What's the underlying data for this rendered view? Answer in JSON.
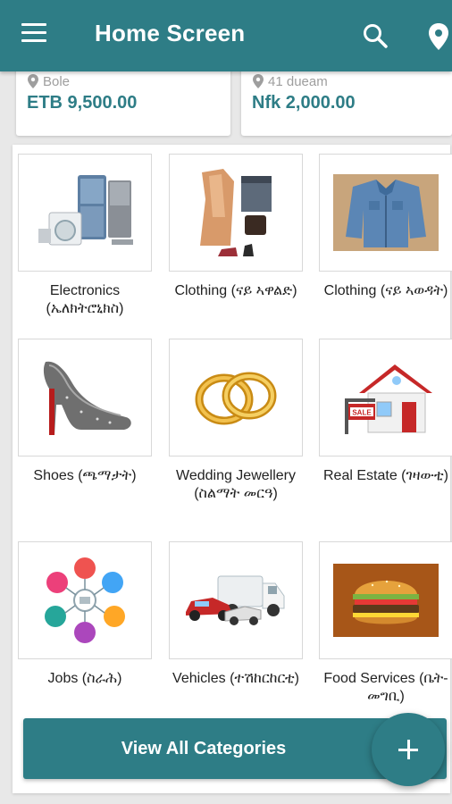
{
  "appbar": {
    "title": "Home Screen",
    "menu_icon": "menu-icon",
    "search_icon": "search-icon",
    "location_icon": "location-pin-icon",
    "color": "#2e7d86"
  },
  "listings": [
    {
      "location": "Bole",
      "price": "ETB 9,500.00"
    },
    {
      "location": "41 dueam",
      "price": "Nfk 2,000.00"
    }
  ],
  "categories": [
    {
      "label": "Electronics (ኤለክትሮኒክስ)",
      "icon": "electronics-image"
    },
    {
      "label": "Clothing (ናይ ኣዋልድ)",
      "icon": "womens-clothing-image"
    },
    {
      "label": "Clothing (ናይ ኣወዳት)",
      "icon": "mens-clothing-image"
    },
    {
      "label": "Shoes (ጫማታት)",
      "icon": "shoes-image"
    },
    {
      "label": "Wedding Jewellery (ስልማት መርዓ)",
      "icon": "wedding-rings-image"
    },
    {
      "label": "Real Estate (ገዛውቲ)",
      "icon": "house-for-sale-image"
    },
    {
      "label": "Jobs (ስራሕ)",
      "icon": "jobs-image"
    },
    {
      "label": "Vehicles (ተሽከርከርቲ)",
      "icon": "vehicles-image"
    },
    {
      "label": "Food Services (ቤት-መግቢ)",
      "icon": "food-burger-image"
    }
  ],
  "view_all_label": "View All Categories",
  "fab_icon": "plus-icon"
}
